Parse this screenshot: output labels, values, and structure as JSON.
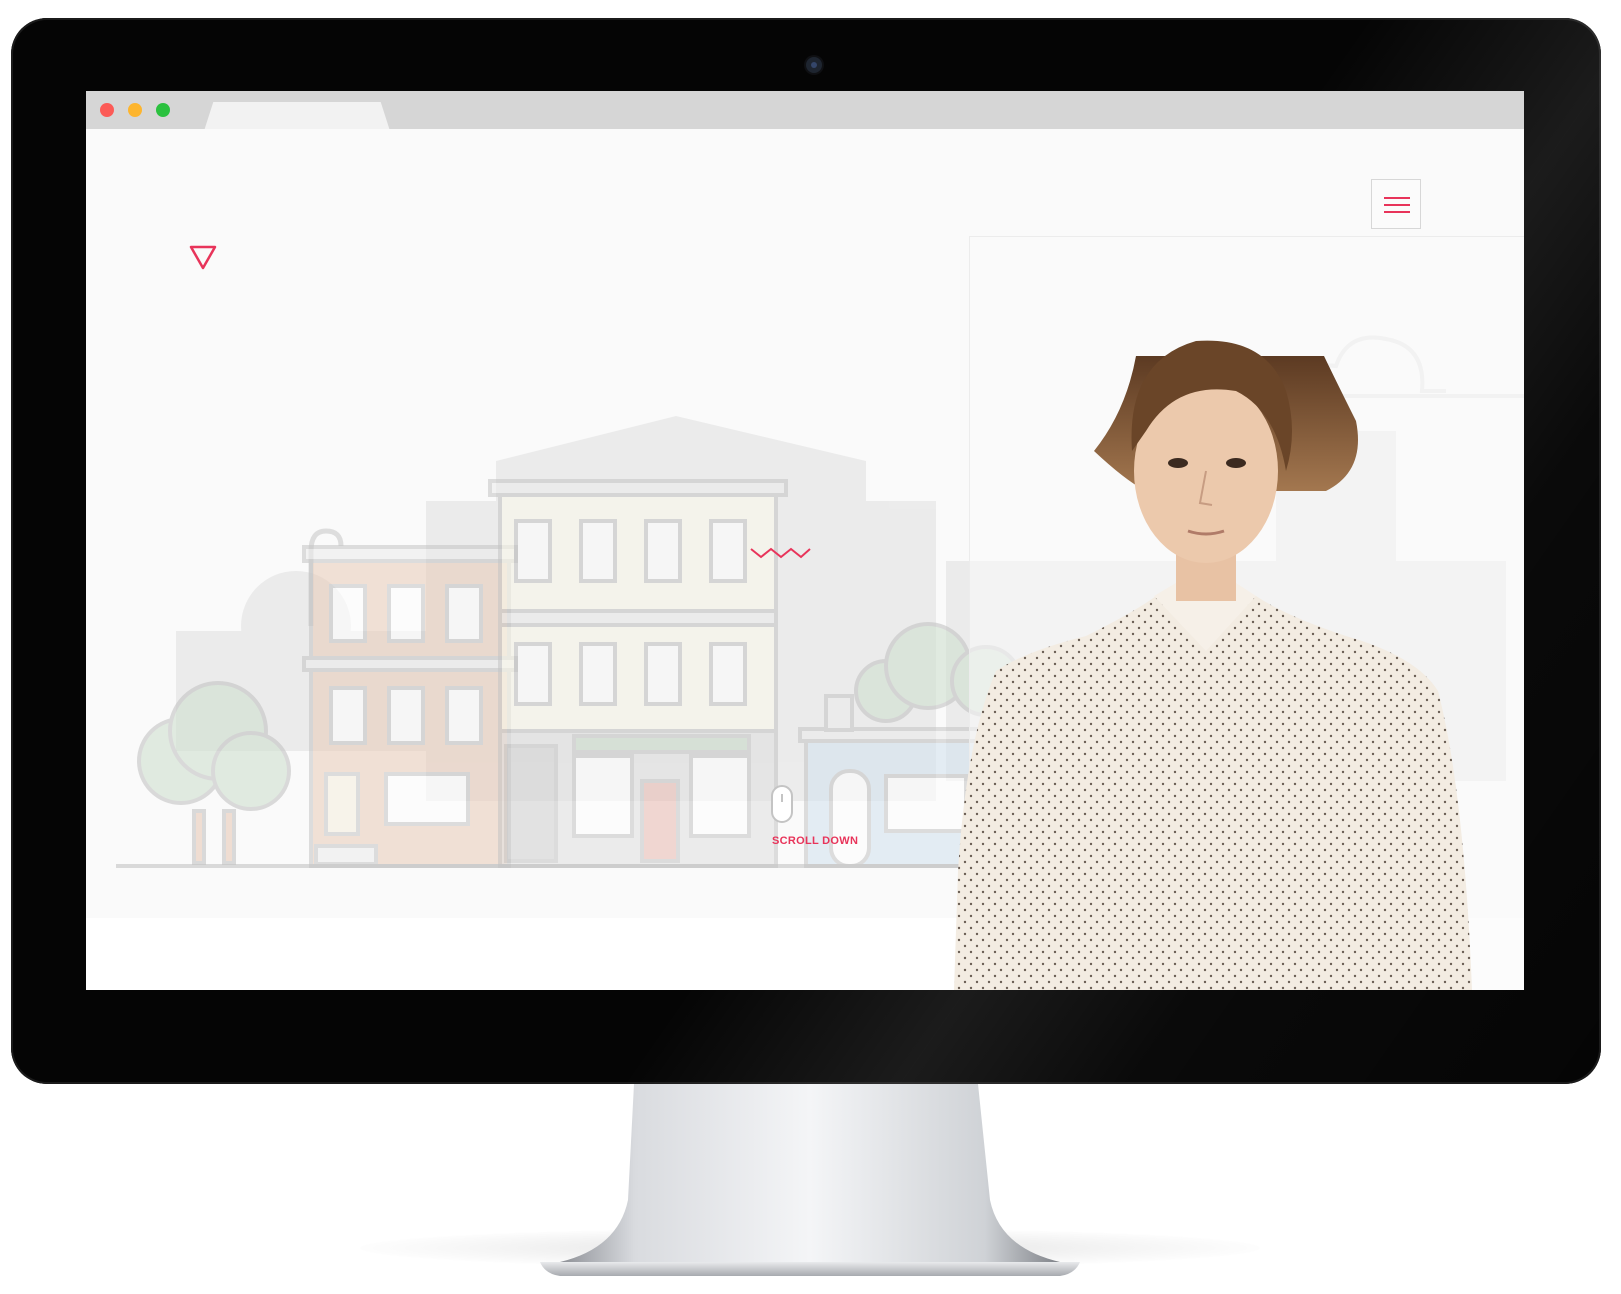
{
  "browser": {
    "window_controls": [
      "close",
      "minimize",
      "maximize"
    ],
    "tab_title": ""
  },
  "page": {
    "logo_icon": "triangle-down-icon",
    "menu_icon": "hamburger-icon",
    "scroll_label": "SCROLL DOWN",
    "accent_color": "#e8345a",
    "illustration": "street-buildings-icon",
    "photo": "person-portrait-icon"
  }
}
